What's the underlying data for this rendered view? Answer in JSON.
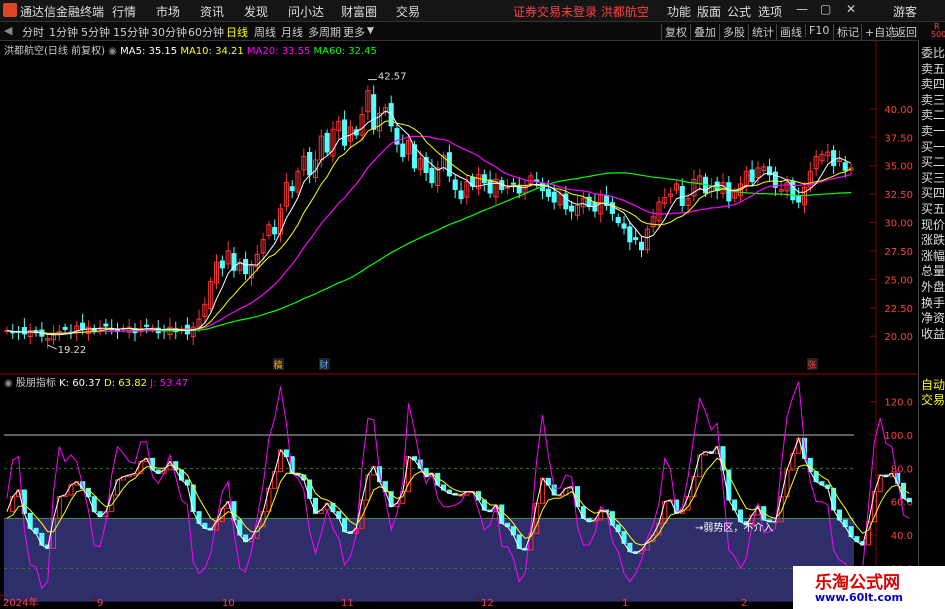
{
  "app": {
    "title": "通达信金融终端",
    "notice": "证券交易未登录 洪都航空"
  },
  "menu": {
    "items": [
      "行情",
      "市场",
      "资讯",
      "发现",
      "问小达",
      "财富圈",
      "交易"
    ],
    "right": [
      "功能",
      "版面",
      "公式",
      "选项"
    ],
    "guest": "游客"
  },
  "toolbar": {
    "periods": [
      "分时",
      "1分钟",
      "5分钟",
      "15分钟",
      "30分钟",
      "60分钟",
      "日线",
      "周线",
      "月线",
      "多周期",
      "更多"
    ],
    "active": "日线",
    "right": [
      "复权",
      "叠加",
      "多股",
      "统计",
      "画线",
      "F10",
      "标记",
      "+自选",
      "返回"
    ]
  },
  "stock": {
    "title": "洪都航空(日线 前复权)"
  },
  "ma": [
    {
      "name": "MA5",
      "value": "35.15",
      "color": "#ffffff"
    },
    {
      "name": "MA10",
      "value": "34.21",
      "color": "#ffff00"
    },
    {
      "name": "MA20",
      "value": "33.55",
      "color": "#ff00ff"
    },
    {
      "name": "MA60",
      "value": "32.45",
      "color": "#00ff00"
    }
  ],
  "indicator": {
    "title": "股朋指标",
    "k": "60.37",
    "d": "63.82",
    "j": "53.47",
    "k_color": "#ffffff",
    "d_color": "#ffff00",
    "j_color": "#ff00ff",
    "zone_label": "弱势区，不介入"
  },
  "sidepanel": {
    "top_labels": [
      "R",
      "500"
    ],
    "items": [
      "委比",
      "卖五",
      "卖四",
      "卖三",
      "卖二",
      "卖一",
      "买一",
      "买二",
      "买三",
      "买四",
      "买五",
      "现价",
      "涨跌",
      "涨幅",
      "总量",
      "外盘",
      "换手",
      "净资",
      "收益",
      "自动",
      "交易"
    ]
  },
  "xaxis": {
    "labels": [
      "2024年",
      "9",
      "10",
      "11",
      "12",
      "1",
      "2"
    ]
  },
  "markers": {
    "left": "稿",
    "mid": "财",
    "right": "张"
  },
  "watermark": {
    "line1": "乐淘公式网",
    "line2": "www.60lt.com"
  },
  "chart_data": [
    {
      "type": "candlestick",
      "title": "洪都航空(日线 前复权)",
      "yticks": [
        20.0,
        22.5,
        25.0,
        27.5,
        30.0,
        32.5,
        35.0,
        37.5,
        40.0
      ],
      "ylim": [
        17.2,
        45.0
      ],
      "annotations": [
        {
          "label": "42.57",
          "value": 42.57
        },
        {
          "label": "19.22",
          "value": 19.22
        }
      ],
      "close": [
        20.5,
        20.3,
        20.4,
        20.2,
        20.5,
        20.3,
        20.0,
        19.8,
        20.1,
        20.4,
        20.6,
        20.3,
        20.9,
        20.6,
        20.8,
        20.5,
        20.7,
        20.9,
        20.6,
        20.4,
        20.7,
        20.8,
        20.3,
        20.6,
        20.9,
        20.7,
        20.3,
        20.5,
        20.8,
        20.4,
        20.6,
        20.2,
        20.8,
        21.5,
        22.8,
        24.8,
        26.5,
        26.0,
        27.5,
        25.8,
        26.5,
        25.5,
        26.2,
        27.2,
        28.5,
        29.8,
        29.0,
        31.2,
        33.5,
        32.8,
        34.5,
        35.8,
        34.2,
        35.5,
        37.6,
        36.2,
        38.2,
        38.9,
        36.8,
        38.4,
        37.7,
        39.5,
        41.6,
        38.2,
        39.6,
        40.1,
        38.5,
        36.9,
        35.8,
        37.2,
        34.8,
        35.6,
        34.4,
        33.5,
        34.8,
        35.9,
        34.1,
        32.9,
        32.1,
        33.6,
        33.2,
        34.2,
        33.5,
        32.6,
        33.8,
        32.9,
        33.1,
        33.4,
        32.6,
        33.2,
        34.1,
        33.6,
        32.8,
        32.3,
        31.8,
        32.5,
        31.2,
        31.0,
        31.5,
        32.1,
        31.4,
        31.0,
        32.4,
        31.5,
        30.8,
        30.0,
        29.5,
        28.3,
        28.5,
        27.6,
        29.4,
        30.5,
        31.8,
        32.2,
        32.5,
        33.4,
        31.5,
        32.1,
        33.8,
        34.1,
        32.6,
        33.2,
        32.8,
        33.5,
        31.9,
        32.7,
        33.4,
        34.5,
        33.6,
        34.8,
        34.9,
        34.2,
        33.1,
        32.9,
        33.5,
        32.0,
        31.8,
        33.1,
        34.5,
        35.8,
        36.0,
        36.2,
        35.0,
        35.5,
        34.6,
        34.8
      ]
    },
    {
      "type": "line",
      "title": "股朋指标",
      "yticks": [
        20.0,
        40.0,
        60.0,
        80.0,
        100.0,
        120.0
      ],
      "ylim": [
        10,
        130
      ],
      "zone": [
        0,
        50
      ],
      "series": [
        {
          "name": "K",
          "values": [
            54,
            63,
            67,
            53,
            44,
            41,
            34,
            32,
            50,
            63,
            64,
            70,
            72,
            68,
            63,
            54,
            51,
            54,
            64,
            73,
            75,
            76,
            77,
            84,
            86,
            79,
            77,
            79,
            84,
            79,
            73,
            70,
            54,
            47,
            44,
            43,
            48,
            56,
            60,
            49,
            40,
            36,
            38,
            45,
            54,
            68,
            78,
            91,
            87,
            77,
            76,
            73,
            62,
            53,
            55,
            59,
            54,
            50,
            42,
            41,
            44,
            61,
            76,
            81,
            72,
            66,
            57,
            59,
            66,
            87,
            85,
            80,
            75,
            77,
            70,
            67,
            65,
            64,
            64,
            66,
            66,
            61,
            55,
            54,
            58,
            47,
            45,
            40,
            32,
            31,
            41,
            59,
            74,
            70,
            64,
            64,
            68,
            69,
            57,
            50,
            48,
            49,
            55,
            54,
            46,
            42,
            35,
            30,
            29,
            31,
            36,
            40,
            47,
            60,
            61,
            53,
            55,
            63,
            75,
            88,
            90,
            89,
            93,
            79,
            61,
            55,
            48,
            46,
            52,
            57,
            49,
            48,
            48,
            63,
            79,
            89,
            98,
            86,
            78,
            72,
            70,
            68,
            55,
            49,
            45,
            39,
            36,
            34,
            48,
            66,
            76,
            75,
            77,
            71,
            62,
            60
          ]
        },
        {
          "name": "D",
          "values": [
            50,
            52,
            57,
            58,
            55,
            51,
            47,
            42,
            42,
            48,
            54,
            61,
            66,
            67,
            67,
            64,
            60,
            57,
            58,
            63,
            68,
            72,
            74,
            78,
            81,
            81,
            80,
            80,
            82,
            81,
            79,
            76,
            69,
            62,
            56,
            50,
            48,
            51,
            54,
            53,
            50,
            45,
            42,
            42,
            46,
            53,
            62,
            72,
            77,
            77,
            77,
            76,
            72,
            65,
            62,
            61,
            59,
            56,
            52,
            48,
            46,
            51,
            59,
            67,
            69,
            68,
            64,
            62,
            63,
            71,
            76,
            78,
            77,
            77,
            74,
            72,
            69,
            67,
            66,
            66,
            66,
            64,
            61,
            58,
            58,
            54,
            51,
            47,
            42,
            38,
            39,
            46,
            55,
            61,
            62,
            62,
            64,
            66,
            63,
            58,
            55,
            53,
            54,
            54,
            51,
            48,
            44,
            39,
            35,
            34,
            35,
            37,
            41,
            47,
            52,
            53,
            54,
            57,
            63,
            71,
            78,
            82,
            86,
            84,
            76,
            69,
            62,
            56,
            55,
            56,
            53,
            51,
            50,
            54,
            63,
            72,
            81,
            82,
            81,
            78,
            75,
            73,
            67,
            61,
            56,
            50,
            45,
            41,
            43,
            51,
            59,
            65,
            69,
            70,
            67,
            65
          ]
        },
        {
          "name": "J",
          "values": [
            62,
            85,
            87,
            43,
            22,
            21,
            8,
            12,
            66,
            93,
            84,
            88,
            84,
            70,
            55,
            34,
            33,
            48,
            76,
            93,
            89,
            84,
            83,
            96,
            96,
            75,
            71,
            77,
            88,
            75,
            61,
            58,
            24,
            17,
            20,
            29,
            48,
            66,
            72,
            41,
            20,
            18,
            30,
            51,
            70,
            98,
            110,
            129,
            107,
            77,
            74,
            67,
            42,
            29,
            41,
            55,
            44,
            38,
            22,
            27,
            40,
            81,
            110,
            109,
            78,
            62,
            43,
            53,
            72,
            119,
            103,
            84,
            71,
            77,
            62,
            57,
            57,
            58,
            60,
            66,
            66,
            55,
            43,
            46,
            58,
            33,
            33,
            26,
            12,
            17,
            45,
            85,
            112,
            88,
            68,
            68,
            76,
            75,
            45,
            34,
            34,
            41,
            57,
            54,
            36,
            30,
            17,
            12,
            17,
            25,
            38,
            46,
            59,
            86,
            79,
            53,
            57,
            75,
            99,
            122,
            114,
            103,
            107,
            69,
            31,
            27,
            20,
            26,
            46,
            59,
            41,
            42,
            44,
            81,
            111,
            123,
            132,
            94,
            72,
            60,
            60,
            58,
            31,
            25,
            23,
            17,
            18,
            20,
            58,
            96,
            110,
            95,
            93,
            73,
            52,
            50
          ]
        }
      ]
    }
  ]
}
